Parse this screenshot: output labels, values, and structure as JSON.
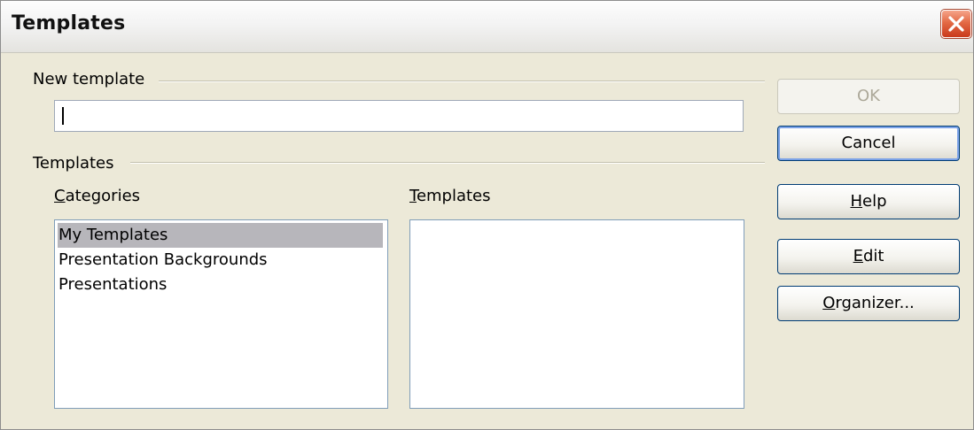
{
  "window": {
    "title": "Templates"
  },
  "new_template": {
    "group_label": "New template",
    "value": ""
  },
  "templates_group": {
    "group_label": "Templates",
    "categories_label": "Categories",
    "categories_mnemonic": "C",
    "templates_label": "Templates",
    "templates_mnemonic": "T",
    "categories": [
      {
        "label": "My Templates",
        "selected": true
      },
      {
        "label": "Presentation Backgrounds",
        "selected": false
      },
      {
        "label": "Presentations",
        "selected": false
      }
    ],
    "templates": []
  },
  "buttons": {
    "ok": "OK",
    "cancel": "Cancel",
    "help": "Help",
    "help_mnemonic": "H",
    "edit": "Edit",
    "edit_mnemonic": "E",
    "organizer": "Organizer...",
    "organizer_mnemonic": "O"
  },
  "colors": {
    "dialog_bg": "#ece9d8",
    "selection": "#b7b6bb",
    "close_button": "#e36a45",
    "button_border": "#003c74"
  }
}
